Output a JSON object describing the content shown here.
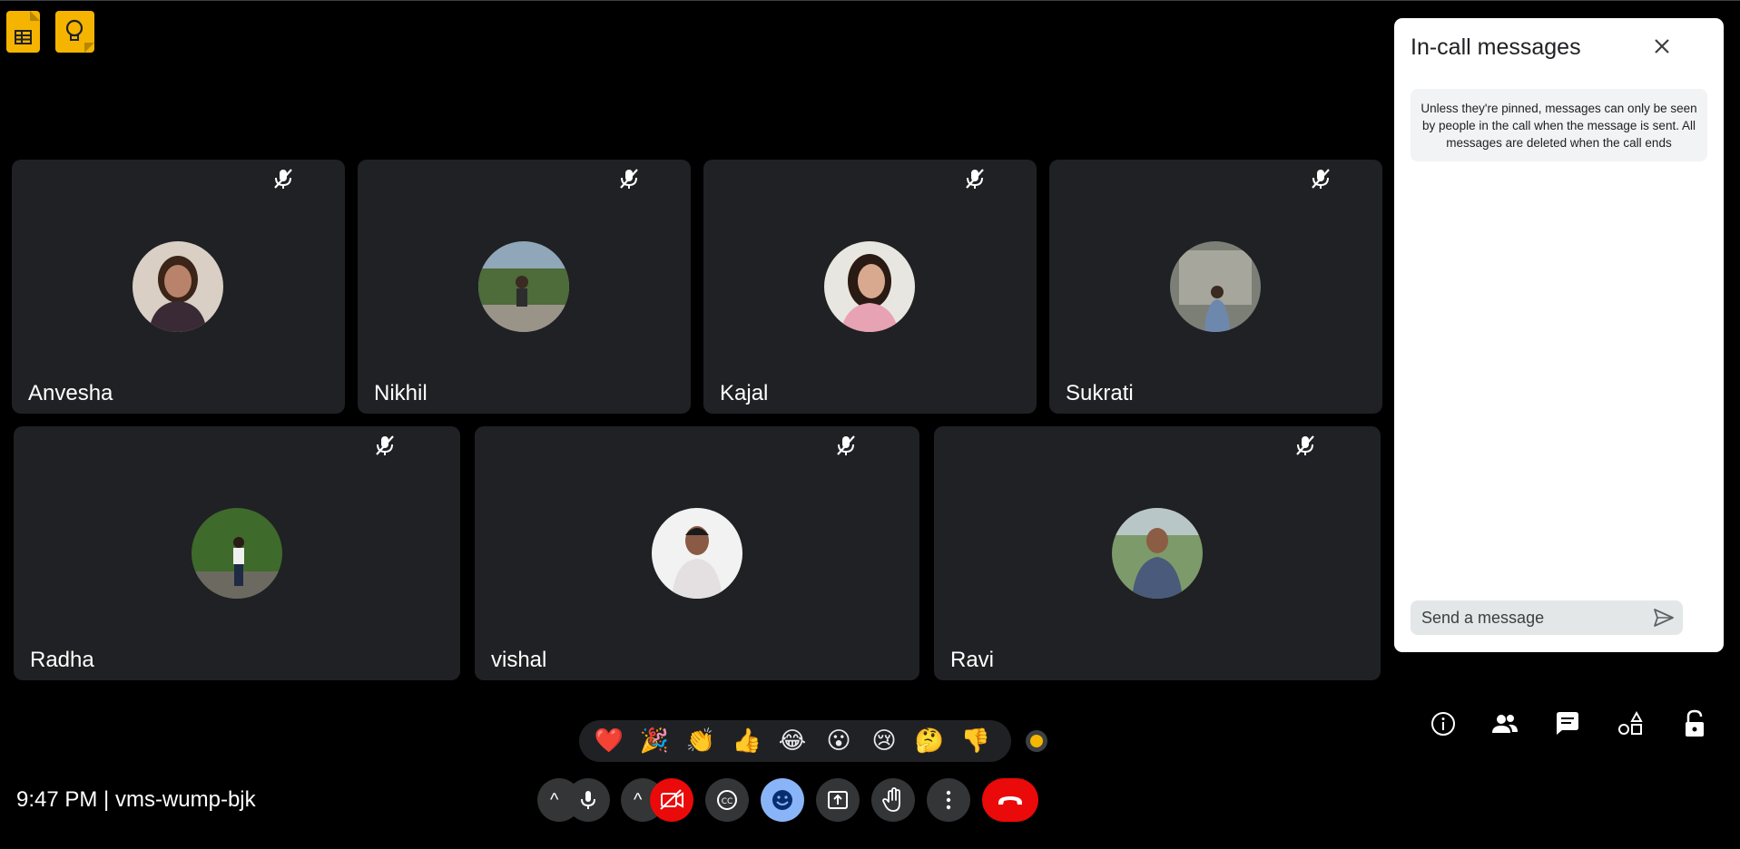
{
  "apps": [
    {
      "icon": "google-sheets-icon",
      "color": "#f4b400"
    },
    {
      "icon": "google-keep-icon",
      "color": "#f4b400"
    }
  ],
  "participants": [
    {
      "name": "Anvesha",
      "muted": true
    },
    {
      "name": "Nikhil",
      "muted": true
    },
    {
      "name": "Kajal",
      "muted": true
    },
    {
      "name": "Sukrati",
      "muted": true
    },
    {
      "name": "Radha",
      "muted": true
    },
    {
      "name": "vishal",
      "muted": true
    },
    {
      "name": "Ravi",
      "muted": true
    }
  ],
  "chat_panel": {
    "title": "In-call messages",
    "notice": "Unless they're pinned, messages can only be seen by people in the call when the message is sent. All messages are deleted when the call ends",
    "input_placeholder": "Send a message",
    "close_icon": "close-icon",
    "send_icon": "send-icon"
  },
  "reactions": [
    "❤️",
    "🎉",
    "👏",
    "👍",
    "😂",
    "😮",
    "😢",
    "🤔",
    "👎"
  ],
  "side_tools": [
    "info-icon",
    "people-icon",
    "chat-icon",
    "activities-icon",
    "lock-icon"
  ],
  "meeting": {
    "time": "9:47 PM",
    "separator": "|",
    "code": "vms-wump-bjk",
    "info_text": "9:47 PM | vms-wump-bjk"
  },
  "controls": {
    "mic_caret": "^",
    "camera_caret": "^",
    "mic": "mic-icon",
    "camera": "camera-off-icon",
    "captions": "captions-icon",
    "reactions": "emoji-icon",
    "present": "present-icon",
    "raise_hand": "hand-icon",
    "more": "more-vert-icon",
    "hangup": "hangup-icon"
  },
  "colors": {
    "background": "#000000",
    "tile": "#202124",
    "hangup_red": "#ea0a0a",
    "camera_off_red": "#ea0a0a",
    "reactions_active_blue": "#8ab4f8",
    "app_yellow": "#f4b400"
  }
}
